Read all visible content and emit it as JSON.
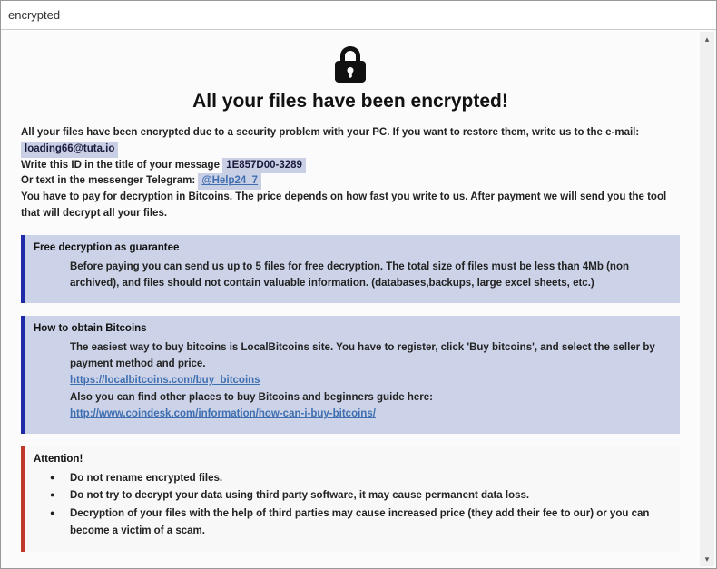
{
  "window": {
    "title": "encrypted"
  },
  "heading": "All your files have been encrypted!",
  "intro": {
    "line1_pre": "All your files have been encrypted due to a security problem with your PC. If you want to restore them, write us to the e-mail: ",
    "email": "loading66@tuta.io",
    "line2_pre": "Write this ID in the title of your message ",
    "id": "1E857D00-3289",
    "line3_pre": "Or text in the messenger Telegram: ",
    "telegram": "@Help24_7",
    "line4": "You have to pay for decryption in Bitcoins. The price depends on how fast you write to us. After payment we will send you the tool that will decrypt all your files."
  },
  "box1": {
    "title": "Free decryption as guarantee",
    "body": "Before paying you can send us up to 5 files for free decryption. The total size of files must be less than 4Mb (non archived), and files should not contain valuable information. (databases,backups, large excel sheets, etc.)"
  },
  "box2": {
    "title": "How to obtain Bitcoins",
    "line1": "The easiest way to buy bitcoins is LocalBitcoins site. You have to register, click 'Buy bitcoins', and select the seller by payment method and price.",
    "link1": "https://localbitcoins.com/buy_bitcoins",
    "line2": "Also you can find other places to buy Bitcoins and beginners guide here:",
    "link2": "http://www.coindesk.com/information/how-can-i-buy-bitcoins/"
  },
  "box3": {
    "title": "Attention!",
    "items": [
      "Do not rename encrypted files.",
      "Do not try to decrypt your data using third party software, it may cause permanent data loss.",
      "Decryption of your files with the help of third parties may cause increased price (they add their fee to our) or you can become a victim of a scam."
    ]
  }
}
